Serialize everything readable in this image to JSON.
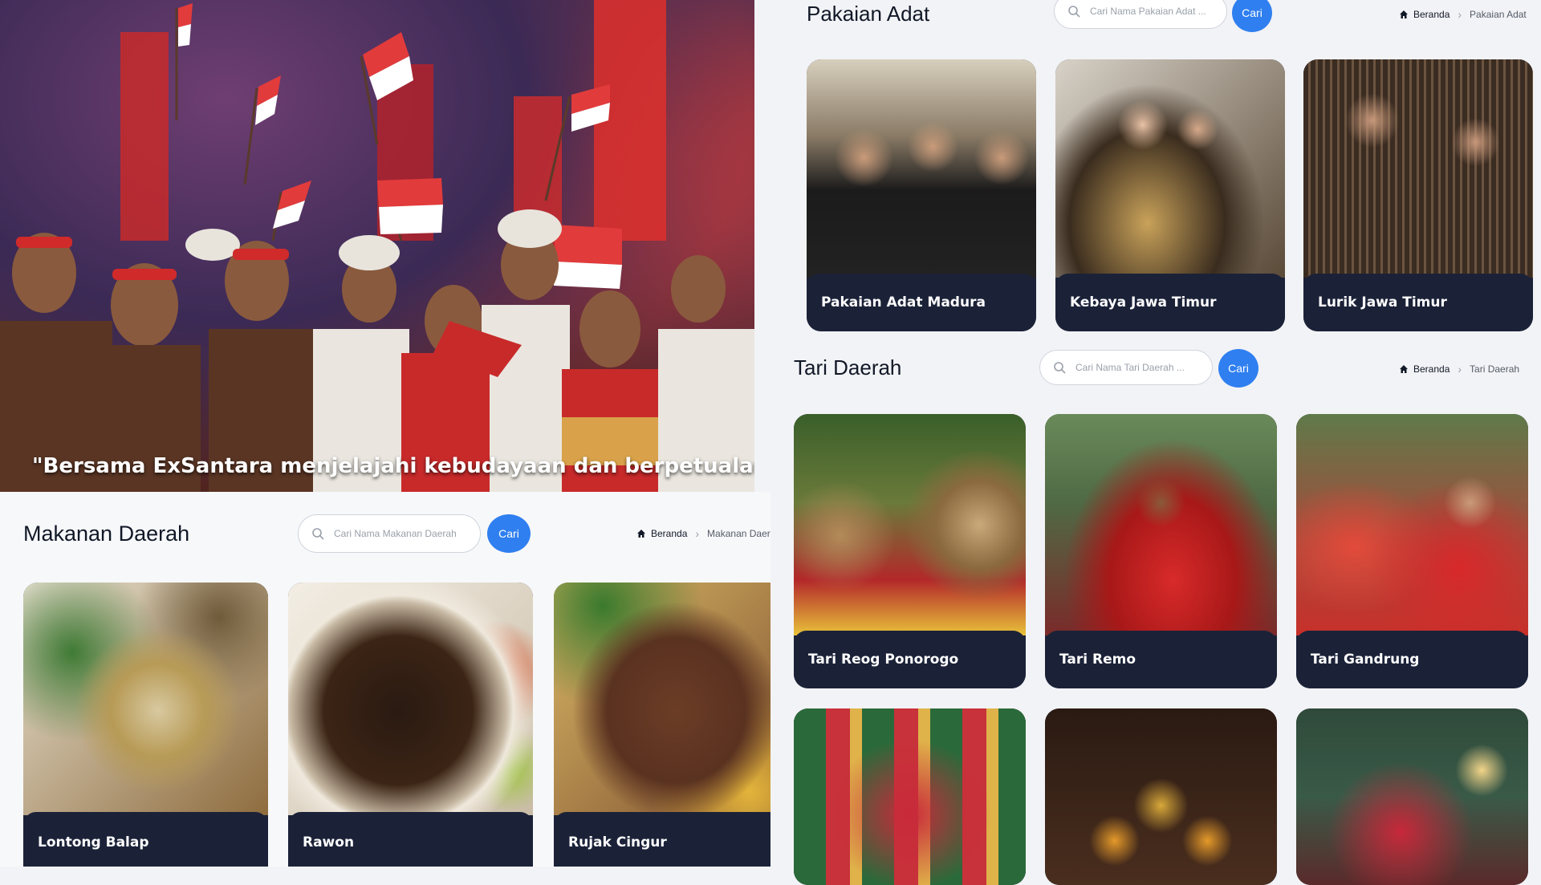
{
  "hero": {
    "quote": "\"Bersama ExSantara menjelajahi kebudayaan dan berpetualang"
  },
  "makanan": {
    "title": "Makanan Daerah",
    "search_placeholder": "Cari Nama Makanan Daerah",
    "button_label": "Cari",
    "breadcrumb": {
      "home": "Beranda",
      "current": "Makanan Daerah"
    },
    "items": [
      {
        "label": "Lontong Balap"
      },
      {
        "label": "Rawon"
      },
      {
        "label": "Rujak Cingur"
      }
    ]
  },
  "pakaian": {
    "title": "Pakaian Adat",
    "search_placeholder": "Cari Nama Pakaian Adat ...",
    "button_label": "Cari",
    "breadcrumb": {
      "home": "Beranda",
      "current": "Pakaian Adat"
    },
    "items": [
      {
        "label": "Pakaian Adat Madura"
      },
      {
        "label": "Kebaya Jawa Timur"
      },
      {
        "label": "Lurik Jawa Timur"
      }
    ]
  },
  "tari": {
    "title": "Tari Daerah",
    "search_placeholder": "Cari Nama Tari Daerah ...",
    "button_label": "Cari",
    "breadcrumb": {
      "home": "Beranda",
      "current": "Tari Daerah"
    },
    "items": [
      {
        "label": "Tari Reog Ponorogo"
      },
      {
        "label": "Tari Remo"
      },
      {
        "label": "Tari Gandrung"
      }
    ]
  },
  "colors": {
    "accent": "#2f7ff0",
    "card_caption": "#1b2238",
    "page_background": "#f2f3f6"
  },
  "icons": {
    "search": "search-icon",
    "home": "home-icon",
    "breadcrumb_separator": "chevron-right-icon"
  }
}
